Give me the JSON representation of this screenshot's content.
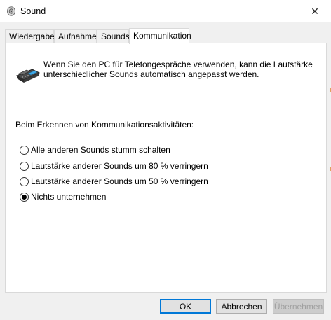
{
  "window": {
    "title": "Sound",
    "close_glyph": "✕"
  },
  "tabs": [
    {
      "label": "Wiedergabe"
    },
    {
      "label": "Aufnahme"
    },
    {
      "label": "Sounds"
    },
    {
      "label": "Kommunikation",
      "active": true
    }
  ],
  "panel": {
    "info_line1": "Wenn Sie den PC für Telefongespräche verwenden, kann die Lautstärke",
    "info_line2": "unterschiedlicher Sounds automatisch angepasst werden.",
    "section_label": "Beim Erkennen von Kommunikationsaktivitäten:",
    "options": [
      {
        "label": "Alle anderen Sounds stumm schalten",
        "selected": false
      },
      {
        "label": "Lautstärke anderer Sounds um 80 % verringern",
        "selected": false
      },
      {
        "label": "Lautstärke anderer Sounds um 50 % verringern",
        "selected": false
      },
      {
        "label": "Nichts unternehmen",
        "selected": true
      }
    ]
  },
  "buttons": {
    "ok": "OK",
    "cancel": "Abbrechen",
    "apply": "Übernehmen"
  },
  "colors": {
    "accent": "#0078d7",
    "dialog_bg": "#f0f0f0"
  },
  "icons": {
    "app": "speaker-icon",
    "communication": "telephone-icon",
    "close": "close-icon"
  }
}
